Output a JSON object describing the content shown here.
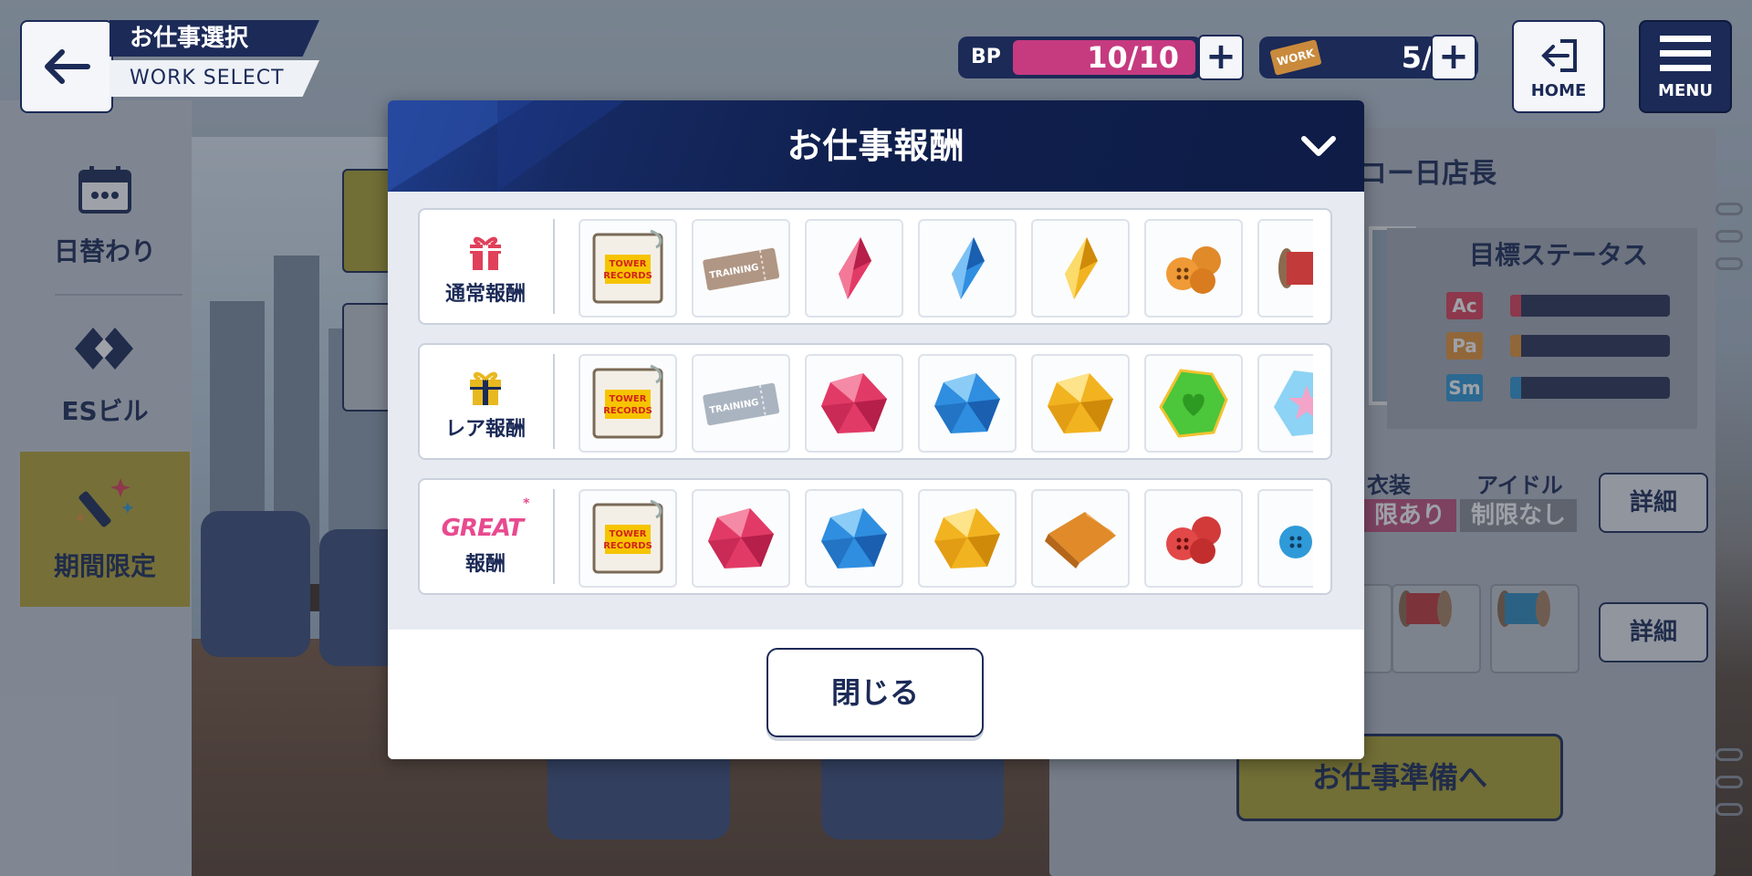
{
  "header": {
    "title_jp": "お仕事選択",
    "title_en": "WORK SELECT",
    "bp": {
      "label": "BP",
      "value": "10/10",
      "fill": 1.0
    },
    "work_tickets": {
      "label": "WORK",
      "value": "5/5"
    },
    "plus": "+",
    "home_label": "HOME",
    "menu_label": "MENU"
  },
  "sidebar": {
    "items": [
      {
        "label": "日替わり",
        "icon": "calendar-icon"
      },
      {
        "label": "ESビル",
        "icon": "es-building-icon"
      },
      {
        "label": "期間限定",
        "icon": "sparkle-stick-icon"
      }
    ]
  },
  "right_panel": {
    "title": "レコー日店長",
    "title_visible": "コー日店長",
    "target_status": "目標ステータス",
    "stats": [
      {
        "tag": "Ac",
        "color": "#e0405a"
      },
      {
        "tag": "Pa",
        "color": "#e7953a"
      },
      {
        "tag": "Sm",
        "color": "#2f9ad8"
      }
    ],
    "costume_label": "衣装",
    "idol_label": "アイドル",
    "costume_badge": "限あり",
    "idol_badge": "制限なし",
    "detail": "詳細",
    "prepare": "お仕事準備へ"
  },
  "modal": {
    "title": "お仕事報酬",
    "rows": [
      {
        "label": "通常報酬",
        "icon": "red-gift-icon",
        "items": [
          "tower-records-card",
          "training-ticket-bronze",
          "red-crystal-shard",
          "blue-crystal-shard",
          "yellow-crystal-shard",
          "orange-buttons",
          "red-thread-spool"
        ]
      },
      {
        "label": "レア報酬",
        "icon": "gold-gift-icon",
        "items": [
          "tower-records-card",
          "training-ticket-silver",
          "red-gem",
          "blue-gem",
          "yellow-gem",
          "green-heart-gem",
          "star-gem"
        ]
      },
      {
        "label": "報酬",
        "logo": "GREAT",
        "icon": "great-logo",
        "items": [
          "tower-records-card",
          "red-gem",
          "blue-gem",
          "yellow-gem",
          "orange-fabric",
          "red-buttons",
          "blue-buttons"
        ]
      }
    ],
    "tower_text_1": "TOWER",
    "tower_text_2": "RECORDS",
    "training_text": "TRAINING",
    "close_label": "閉じる"
  }
}
